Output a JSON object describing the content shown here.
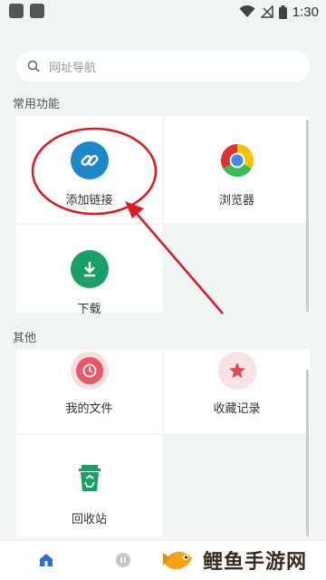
{
  "status": {
    "time": "1:30"
  },
  "search": {
    "placeholder": "网址导航"
  },
  "sections": {
    "common": "常用功能",
    "other": "其他"
  },
  "common_items": [
    {
      "label": "添加链接",
      "icon": "link-icon",
      "color": "#1e88c8"
    },
    {
      "label": "浏览器",
      "icon": "chrome-icon"
    },
    {
      "label": "下载",
      "icon": "download-icon",
      "color": "#1aa066"
    }
  ],
  "other_items": [
    {
      "label": "我的文件",
      "icon": "clock-icon",
      "color": "#e85a66"
    },
    {
      "label": "收藏记录",
      "icon": "star-icon",
      "color": "#e04a55"
    },
    {
      "label": "回收站",
      "icon": "recycle-bin-icon",
      "color": "#1aa066"
    }
  ],
  "watermark": {
    "text": "鲤鱼手游网"
  },
  "colors": {
    "annotation": "#d42027",
    "accent": "#2a6fd6"
  }
}
